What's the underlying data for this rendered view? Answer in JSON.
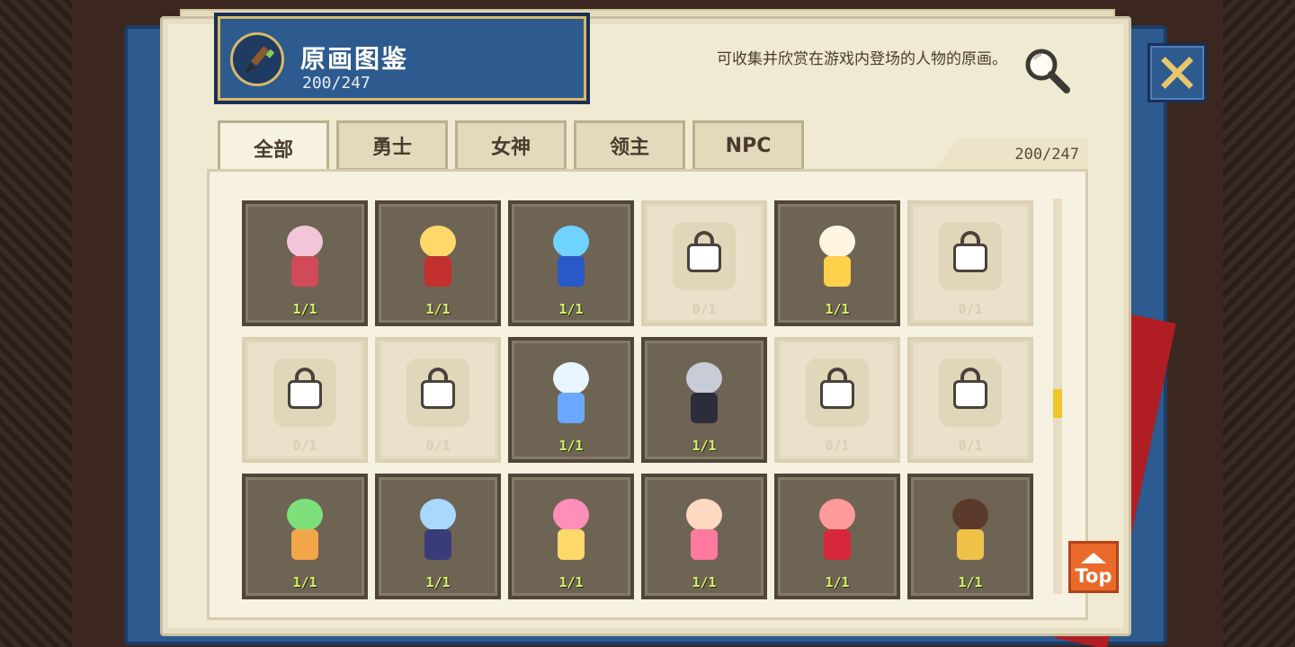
{
  "header": {
    "title": "原画图鉴",
    "count": "200/247",
    "description": "可收集并欣赏在游戏内登场的人物的原画。",
    "search_icon": "magnifier-icon",
    "close_icon": "close-x-icon"
  },
  "tabs": [
    {
      "label": "全部",
      "active": true
    },
    {
      "label": "勇士",
      "active": false
    },
    {
      "label": "女神",
      "active": false
    },
    {
      "label": "领主",
      "active": false
    },
    {
      "label": "NPC",
      "active": false
    }
  ],
  "tab_count": "200/247",
  "grid": {
    "items": [
      {
        "count": "1/1",
        "locked": false,
        "palette": [
          "#f2c6d8",
          "#d04a5a"
        ]
      },
      {
        "count": "1/1",
        "locked": false,
        "palette": [
          "#ffd86a",
          "#c2302f"
        ]
      },
      {
        "count": "1/1",
        "locked": false,
        "palette": [
          "#6fd2ff",
          "#2a58c8"
        ]
      },
      {
        "count": "0/1",
        "locked": true
      },
      {
        "count": "1/1",
        "locked": false,
        "palette": [
          "#fff4df",
          "#ffd04a"
        ]
      },
      {
        "count": "0/1",
        "locked": true
      },
      {
        "count": "0/1",
        "locked": true
      },
      {
        "count": "0/1",
        "locked": true
      },
      {
        "count": "1/1",
        "locked": false,
        "palette": [
          "#e8f4ff",
          "#6aa8ff"
        ]
      },
      {
        "count": "1/1",
        "locked": false,
        "palette": [
          "#c8ccd6",
          "#2b2d3a"
        ]
      },
      {
        "count": "0/1",
        "locked": true
      },
      {
        "count": "0/1",
        "locked": true
      },
      {
        "count": "1/1",
        "locked": false,
        "palette": [
          "#7ee07a",
          "#f2a64a"
        ]
      },
      {
        "count": "1/1",
        "locked": false,
        "palette": [
          "#a9d8ff",
          "#3a3c7a"
        ]
      },
      {
        "count": "1/1",
        "locked": false,
        "palette": [
          "#ff8fb8",
          "#ffd86a"
        ]
      },
      {
        "count": "1/1",
        "locked": false,
        "palette": [
          "#ffd8c2",
          "#ff7aa0"
        ]
      },
      {
        "count": "1/1",
        "locked": false,
        "palette": [
          "#ff9b9b",
          "#d6283a"
        ]
      },
      {
        "count": "1/1",
        "locked": false,
        "palette": [
          "#5a3a2a",
          "#f0c24a"
        ]
      }
    ]
  },
  "scroll_position": 0.52,
  "top_button": {
    "label": "Top"
  },
  "colors": {
    "book_cover": "#2d5a8f",
    "page": "#f1ead3",
    "accent_yellow": "#f0c629",
    "top_button": "#ea6a2c",
    "ribbon": "#b01d22"
  }
}
